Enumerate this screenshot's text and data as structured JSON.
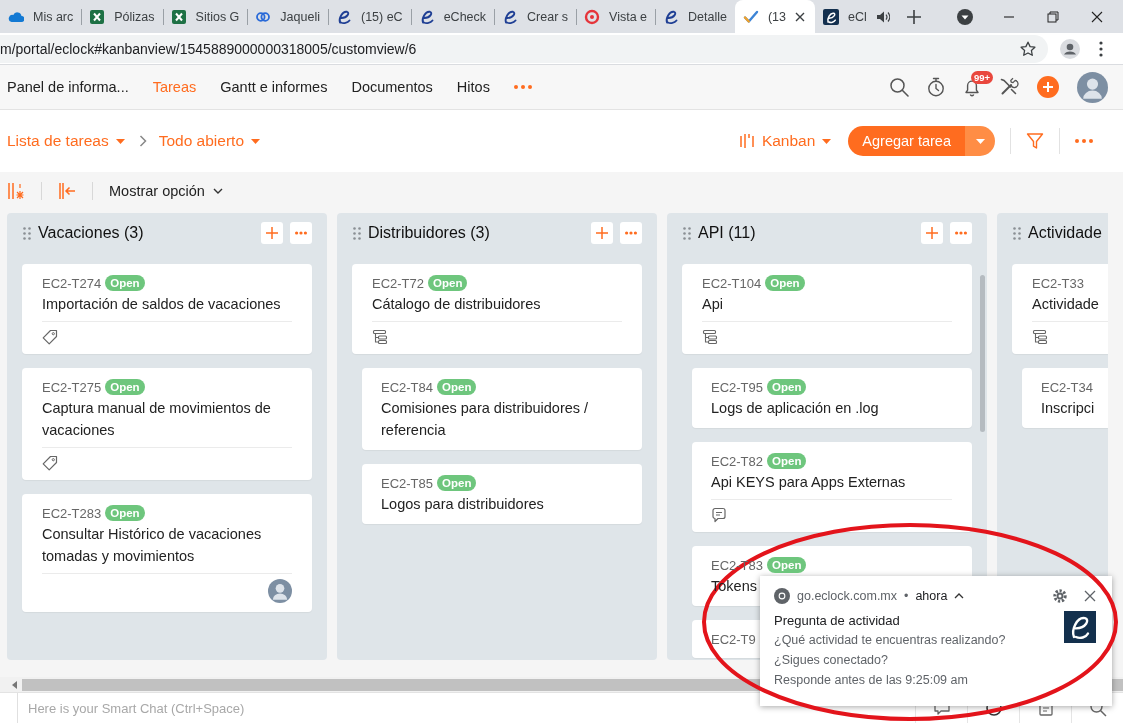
{
  "browser": {
    "tabs": [
      {
        "label": "Mis arc",
        "kind": "cloud",
        "selected": false,
        "audio": false
      },
      {
        "label": "Pólizas",
        "kind": "sheet",
        "selected": false,
        "audio": false
      },
      {
        "label": "Sitios G",
        "kind": "sheet",
        "selected": false,
        "audio": false
      },
      {
        "label": "Jaqueli",
        "kind": "rings",
        "selected": false,
        "audio": false
      },
      {
        "label": "(15) eC",
        "kind": "script",
        "selected": false,
        "audio": false
      },
      {
        "label": "eCheck",
        "kind": "script",
        "selected": false,
        "audio": false
      },
      {
        "label": "Crear s",
        "kind": "script",
        "selected": false,
        "audio": false
      },
      {
        "label": "Vista e",
        "kind": "target",
        "selected": false,
        "audio": false
      },
      {
        "label": "Detalle",
        "kind": "script",
        "selected": false,
        "audio": false
      },
      {
        "label": "(13",
        "kind": "check",
        "selected": true,
        "audio": false
      },
      {
        "label": "eCl",
        "kind": "logo",
        "selected": false,
        "audio": true
      }
    ],
    "url": "m/portal/eclock#kanbanview/1545889000000318005/customview/6"
  },
  "app_nav": {
    "items": [
      {
        "label": "Panel de informa...",
        "selected": false
      },
      {
        "label": "Tareas",
        "selected": true
      },
      {
        "label": "Gantt e informes",
        "selected": false
      },
      {
        "label": "Documentos",
        "selected": false
      },
      {
        "label": "Hitos",
        "selected": false
      }
    ],
    "notification_count": "99+"
  },
  "task_header": {
    "list_selector": "Lista de tareas",
    "filter_selector": "Todo abierto",
    "view_selector": "Kanban",
    "add_button": "Agregar tarea"
  },
  "toolbar": {
    "options_button": "Mostrar opción"
  },
  "columns": [
    {
      "title": "Vacaciones (3)",
      "header_buttons": true,
      "scrollbar": false,
      "cards": [
        {
          "id": "EC2-T274",
          "badge": "Open",
          "title": "Importación de saldos de vacaciones",
          "footer": {
            "kind": "tag"
          }
        },
        {
          "id": "EC2-T275",
          "badge": "Open",
          "title": "Captura manual de movimientos de vacaciones",
          "footer": {
            "kind": "tag"
          }
        },
        {
          "id": "EC2-T283",
          "badge": "Open",
          "title": "Consultar Histórico de vacaciones tomadas y movimientos",
          "footer": {
            "kind": "assignee"
          }
        }
      ]
    },
    {
      "title": "Distribuidores (3)",
      "header_buttons": true,
      "scrollbar": false,
      "cards": [
        {
          "id": "EC2-T72",
          "badge": "Open",
          "title": "Cátalogo de distribuidores",
          "footer": {
            "kind": "subtasks"
          },
          "children": [
            {
              "id": "EC2-T84",
              "badge": "Open",
              "title": "Comisiones para distribuidores / referencia"
            },
            {
              "id": "EC2-T85",
              "badge": "Open",
              "title": "Logos para distribuidores"
            }
          ]
        }
      ]
    },
    {
      "title": "API (11)",
      "header_buttons": true,
      "scrollbar": true,
      "cards": [
        {
          "id": "EC2-T104",
          "badge": "Open",
          "title": "Api",
          "footer": {
            "kind": "subtasks"
          },
          "children": [
            {
              "id": "EC2-T95",
              "badge": "Open",
              "title": "Logs de aplicación en .log"
            },
            {
              "id": "EC2-T82",
              "badge": "Open",
              "title": "Api KEYS para Apps Externas",
              "footer": {
                "kind": "comments"
              }
            },
            {
              "id": "EC2-T83",
              "badge": "Open",
              "title": "Tokens"
            },
            {
              "id": "EC2-T9"
            }
          ]
        }
      ]
    },
    {
      "title": "Actividade",
      "header_buttons": false,
      "scrollbar": false,
      "cards": [
        {
          "id": "EC2-T33",
          "title": "Actividade",
          "footer": {
            "kind": "subtasks"
          },
          "children": [
            {
              "id": "EC2-T34",
              "title": "Inscripci"
            }
          ]
        }
      ]
    }
  ],
  "smart_chat": {
    "placeholder": "Here is your Smart Chat (Ctrl+Space)"
  },
  "notification": {
    "source": "go.eclock.com.mx",
    "separator": "•",
    "time": "ahora",
    "title": "Pregunta de actividad",
    "lines": [
      "¿Qué actividad te encuentras realizando?",
      "¿Sigues conectado?",
      "Responde antes de las 9:25:09 am"
    ]
  },
  "annotations": [
    {
      "kind": "ellipse"
    }
  ]
}
